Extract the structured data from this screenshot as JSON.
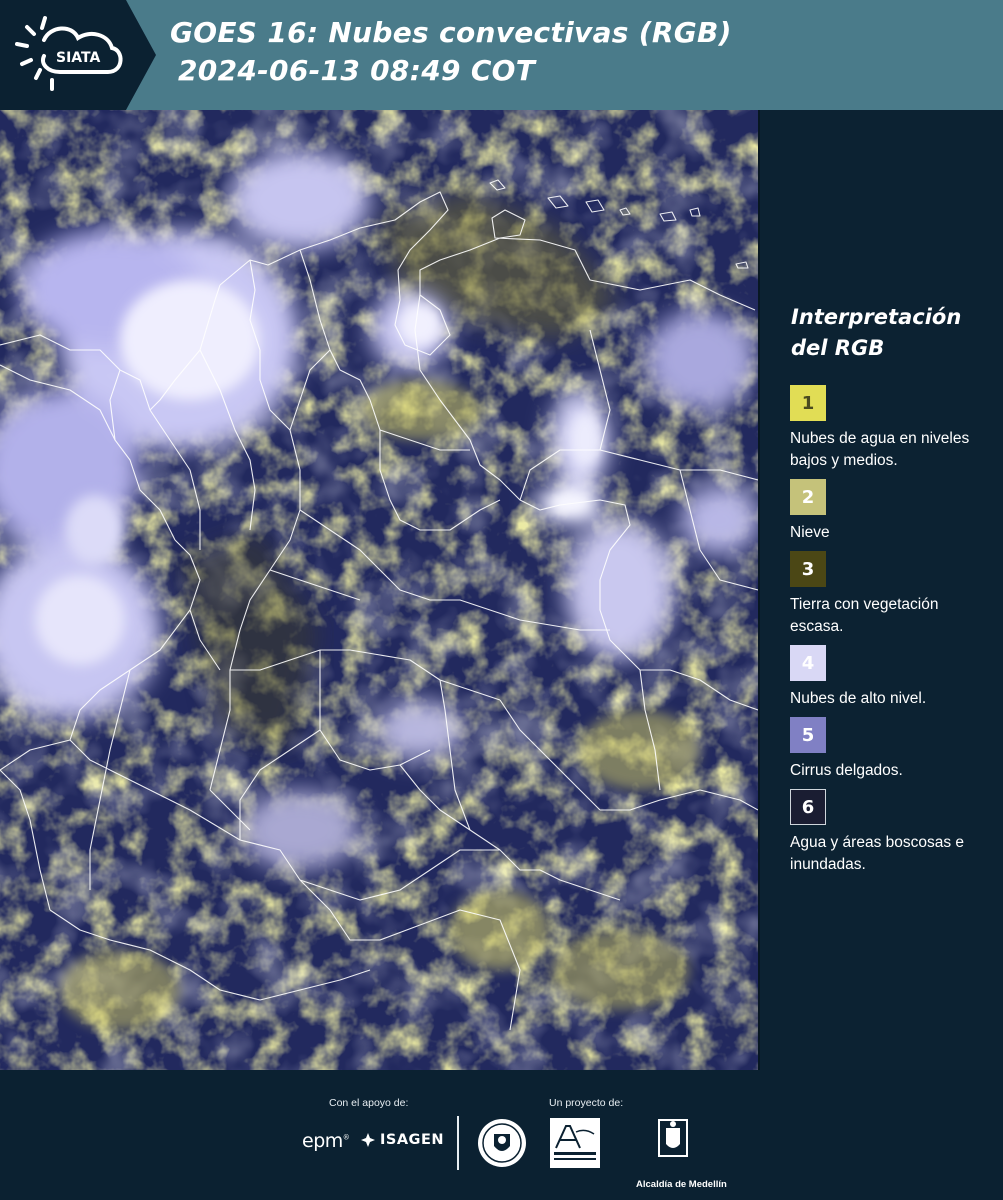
{
  "header": {
    "logo_text": "SIATA",
    "title_line1": "GOES 16: Nubes convectivas (RGB)",
    "title_line2": "2024-06-13 08:49 COT"
  },
  "map": {
    "icon": "satellite-rgb-map"
  },
  "legend": {
    "title_line1": "Interpretación",
    "title_line2": "del RGB",
    "items": [
      {
        "number": "1",
        "label": "Nubes de agua en niveles bajos y medios.",
        "color": "#e1dd55",
        "text_color": "#4a4a20"
      },
      {
        "number": "2",
        "label": "Nieve",
        "color": "#c5c27a",
        "text_color": "#ffffff"
      },
      {
        "number": "3",
        "label": "Tierra con vegetación escasa.",
        "color": "#4b4715",
        "text_color": "#ffffff"
      },
      {
        "number": "4",
        "label": "Nubes de alto nivel.",
        "color": "#d9d8f5",
        "text_color": "#ffffff"
      },
      {
        "number": "5",
        "label": "Cirrus delgados.",
        "color": "#8080c4",
        "text_color": "#ffffff"
      },
      {
        "number": "6",
        "label": "Agua y áreas boscosas e inundadas.",
        "color": "#1a1d32",
        "text_color": "#ffffff"
      }
    ]
  },
  "footer": {
    "support_label": "Con el apoyo de:",
    "project_label": "Un proyecto de:",
    "epm": "epm",
    "isagen": "ISAGEN",
    "area_logo": "Área Metropolitana Valle de Aburrá",
    "alcaldia": "Alcaldía de Medellín"
  },
  "colors": {
    "header_bg": "#4a7b8a",
    "panel_bg": "#0c2232"
  }
}
